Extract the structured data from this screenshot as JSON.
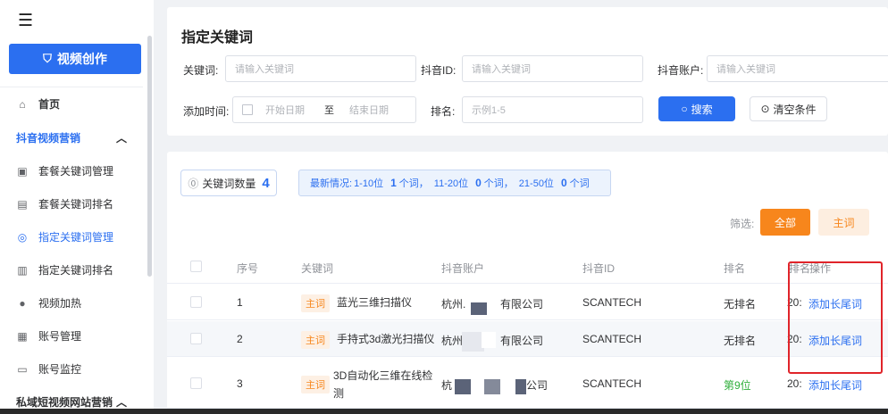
{
  "sidebar": {
    "create_label": "视频创作",
    "home": "首页",
    "group1": "抖音视频营销",
    "items": [
      {
        "label": "套餐关键词管理",
        "icon": "package-keyword-icon"
      },
      {
        "label": "套餐关键词排名",
        "icon": "package-rank-icon"
      },
      {
        "label": "指定关键词管理",
        "icon": "target-keyword-icon"
      },
      {
        "label": "指定关键词排名",
        "icon": "bar-chart-icon"
      },
      {
        "label": "视频加热",
        "icon": "flame-icon"
      },
      {
        "label": "账号管理",
        "icon": "account-icon"
      },
      {
        "label": "账号监控",
        "icon": "monitor-icon"
      }
    ],
    "group2": "私域短视频网站营销"
  },
  "filter": {
    "title": "指定关键词",
    "keyword_label": "关键词:",
    "keyword_placeholder": "请输入关键词",
    "douyin_id_label": "抖音ID:",
    "douyin_id_placeholder": "请输入关键词",
    "account_label": "抖音账户:",
    "account_placeholder": "请输入关键词",
    "add_time_label": "添加时间:",
    "start_date": "开始日期",
    "date_sep": "至",
    "end_date": "结束日期",
    "rank_label": "排名:",
    "rank_placeholder": "示例1-5",
    "search_label": "搜索",
    "clear_label": "清空条件"
  },
  "summary": {
    "kw_count_label": "关键词数量",
    "kw_count": "4",
    "latest_prefix": "最新情况:",
    "r1_range": "1-10位",
    "r1_count": "1",
    "r1_unit": "个词，",
    "r2_range": "11-20位",
    "r2_count": "0",
    "r2_unit": "个词，",
    "r3_range": "21-50位",
    "r3_count": "0",
    "r3_unit": "个词",
    "filter_label": "筛选:",
    "all_label": "全部",
    "main_label": "主词"
  },
  "table": {
    "headers": {
      "index": "序号",
      "keyword": "关键词",
      "account": "抖音账户",
      "douyin_id": "抖音ID",
      "rank": "排名",
      "date_partial": "排名",
      "action": "操作"
    },
    "rows": [
      {
        "index": "1",
        "tag": "主词",
        "keyword": "蓝光三维扫描仪",
        "account_a": "杭州.",
        "account_b": "有限公司",
        "douyin_id": "SCANTECH",
        "rank": "无排名",
        "date": "20:",
        "action": "添加长尾词"
      },
      {
        "index": "2",
        "tag": "主词",
        "keyword": "手持式3d激光扫描仪",
        "account_a": "杭州",
        "account_b": "有限公司",
        "douyin_id": "SCANTECH",
        "rank": "无排名",
        "date": "20:",
        "action": "添加长尾词"
      },
      {
        "index": "3",
        "tag": "主词",
        "keyword_l1": "3D自动化三维在线检",
        "keyword_l2": "测",
        "account_a": "杭",
        "account_b": "公司",
        "douyin_id": "SCANTECH",
        "rank": "第9位",
        "date": "20:",
        "action": "添加长尾词"
      }
    ]
  },
  "colors": {
    "accent": "#2b6ff0",
    "orange": "#f7861c",
    "green": "#2eae3a",
    "highlight": "#e0242a"
  }
}
